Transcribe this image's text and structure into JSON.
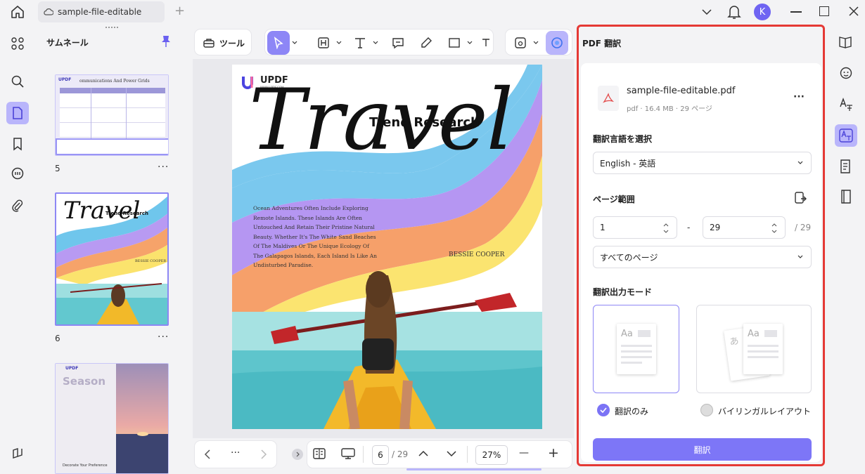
{
  "titlebar": {
    "tab_title": "sample-file-editable",
    "add_tab": "+",
    "avatar_initial": "K"
  },
  "thumbnails": {
    "title": "サムネール",
    "pages": [
      {
        "number": "5",
        "more": "···"
      },
      {
        "number": "6",
        "more": "···"
      },
      {
        "number": "",
        "more": ""
      }
    ],
    "thumb5_header": "ommunications And Power Grids",
    "thumb6_title": "Travel",
    "thumb6_subtitle": "Trend Research",
    "thumb6_author": "BESSIE COOPER",
    "thumb7_title": "Season",
    "thumb7_footer": "Decorate Your Preference",
    "logo": "UPDF"
  },
  "toolbar": {
    "tools_label": "ツール"
  },
  "document": {
    "logo": "UPDF",
    "logo_url": "WWW.UPDF.COM",
    "script_title": "Travel",
    "subtitle": "Trend Research",
    "body": "Ocean Adventures Often Include Exploring Remote Islands. These Islands Are Often Untouched And Retain Their Pristine Natural Beauty. Whether It's The White Sand Beaches Of The Maldives Or The Unique Ecology Of The Galapagos Islands, Each Island Is Like An Undisturbed Paradise.",
    "author": "BESSIE COOPER"
  },
  "pager": {
    "more": "···",
    "current_page": "6",
    "total": "/ 29",
    "zoom": "27%",
    "zoom_out": "—",
    "zoom_in": "+"
  },
  "translate": {
    "panel_title": "PDF 翻訳",
    "file_name": "sample-file-editable.pdf",
    "file_meta": "pdf · 16.4 MB · 29 ページ",
    "more": "···",
    "language_label": "翻訳言語を選択",
    "language_value": "English - 英語",
    "range_label": "ページ範囲",
    "range_from": "1",
    "range_dash": "-",
    "range_to": "29",
    "range_total": "/ 29",
    "page_filter": "すべてのページ",
    "mode_label": "翻訳出力モード",
    "mode_only": "翻訳のみ",
    "mode_bilingual": "バイリンガルレイアウト",
    "doc_aa": "Aa",
    "doc_a": "あ",
    "translate_button": "翻訳"
  },
  "colors": {
    "accent": "#7b73f5",
    "accent_light": "#b9b5fb",
    "highlight": "#e53935",
    "button": "#7d76f7"
  }
}
